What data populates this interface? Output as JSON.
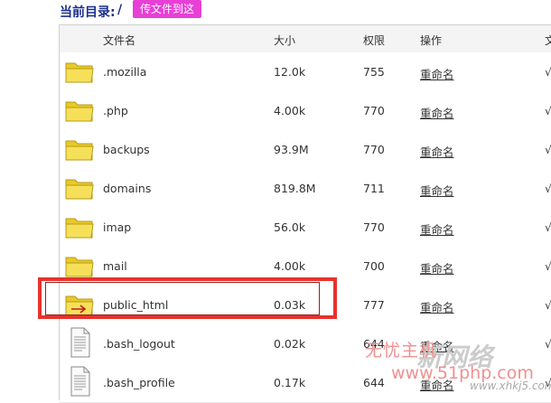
{
  "header": {
    "path_label": "当前目录:",
    "path_value": "/",
    "upload_button": "传文件到这"
  },
  "columns": {
    "name": "文件名",
    "size": "大小",
    "perm": "权限",
    "action": "操作",
    "extra": "文"
  },
  "rows": [
    {
      "name": ".mozilla",
      "size": "12.0k",
      "perm": "755",
      "action": "重命名",
      "extra": "√",
      "type": "folder"
    },
    {
      "name": ".php",
      "size": "4.00k",
      "perm": "770",
      "action": "重命名",
      "extra": "√",
      "type": "folder"
    },
    {
      "name": "backups",
      "size": "93.9M",
      "perm": "770",
      "action": "重命名",
      "extra": "√",
      "type": "folder"
    },
    {
      "name": "domains",
      "size": "819.8M",
      "perm": "711",
      "action": "重命名",
      "extra": "√",
      "type": "folder"
    },
    {
      "name": "imap",
      "size": "56.0k",
      "perm": "770",
      "action": "重命名",
      "extra": "√",
      "type": "folder"
    },
    {
      "name": "mail",
      "size": "4.00k",
      "perm": "700",
      "action": "重命名",
      "extra": "√",
      "type": "folder"
    },
    {
      "name": "public_html",
      "size": "0.03k",
      "perm": "777",
      "action": "重命名",
      "extra": "√",
      "type": "folder-link"
    },
    {
      "name": ".bash_logout",
      "size": "0.02k",
      "perm": "644",
      "action": "重命名",
      "extra": "√",
      "type": "file"
    },
    {
      "name": ".bash_profile",
      "size": "0.17k",
      "perm": "644",
      "action": "重命名",
      "extra": "√",
      "type": "file"
    }
  ],
  "watermark": {
    "brand_cn": "无忧主机",
    "brand_url": "www.51php.com",
    "logo_text": "新网络",
    "site": "www.xhkj5.com"
  },
  "colors": {
    "upload_button_bg": "#e83fd6",
    "path_text": "#1a2f8f",
    "highlight_border": "#e8322c",
    "folder_fill": "#f3da3a"
  },
  "icons": {
    "folder": "folder-icon",
    "folder_link": "folder-link-icon",
    "file": "document-icon"
  }
}
